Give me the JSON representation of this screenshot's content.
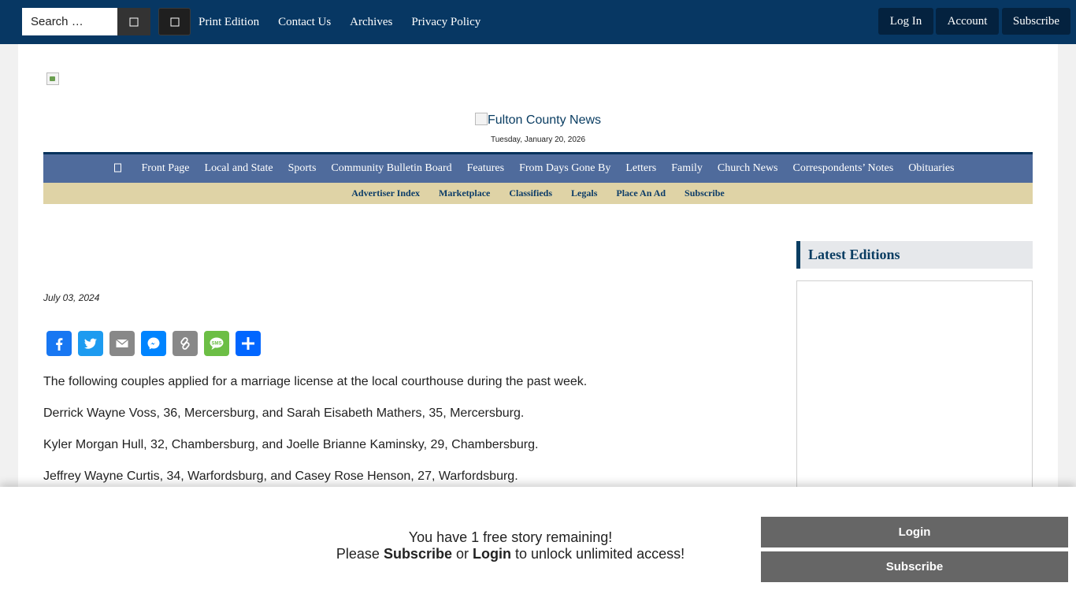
{
  "topbar": {
    "search_placeholder": "Search …",
    "links": [
      "Print Edition",
      "Contact Us",
      "Archives",
      "Privacy Policy"
    ],
    "login_label": "Log In",
    "account_label": "Account",
    "subscribe_label": "Subscribe",
    "bg_color": "#073763"
  },
  "masthead": {
    "logo_alt": "Fulton County News",
    "date": "Tuesday, January 20, 2026"
  },
  "nav": {
    "items": [
      "Front Page",
      "Local and State",
      "Sports",
      "Community Bulletin Board",
      "Features",
      "From Days Gone By",
      "Letters",
      "Family",
      "Church News",
      "Correspondents’ Notes",
      "Obituaries"
    ],
    "bg_color": "#4f6b9c"
  },
  "subnav": {
    "items": [
      "Advertiser Index",
      "Marketplace",
      "Classifieds",
      "Legals",
      "Place An Ad",
      "Subscribe"
    ],
    "bg_color": "#dfd3a6"
  },
  "article": {
    "date": "July 03, 2024",
    "share": [
      {
        "name": "facebook-icon",
        "color": "#1877f2"
      },
      {
        "name": "twitter-icon",
        "color": "#1d9bf0"
      },
      {
        "name": "email-icon",
        "color": "#888888"
      },
      {
        "name": "messenger-icon",
        "color": "#0084ff"
      },
      {
        "name": "copy-link-icon",
        "color": "#888888"
      },
      {
        "name": "sms-icon",
        "color": "#6cbe45"
      },
      {
        "name": "share-icon",
        "color": "#0166ff"
      }
    ],
    "paragraphs": [
      "The following couples applied for a marriage license at the local courthouse during the past week.",
      "Derrick Wayne Voss, 36, Mercersburg, and Sarah Eisabeth Mathers, 35, Mercersburg.",
      "Kyler Morgan Hull, 32, Chambersburg, and Joelle Brianne Kaminsky, 29, Chambersburg.",
      "Jeffrey Wayne Curtis, 34, Warfordsburg, and Casey Rose Henson, 27, Warfordsburg."
    ]
  },
  "sidebar": {
    "heading": "Latest Editions"
  },
  "paywall": {
    "line1": "You have 1 free story remaining!",
    "please": "Please",
    "subscribe_word": "Subscribe",
    "or": "or",
    "login_word": "Login",
    "tail": "to unlock unlimited access!",
    "login_button": "Login",
    "subscribe_button": "Subscribe"
  }
}
